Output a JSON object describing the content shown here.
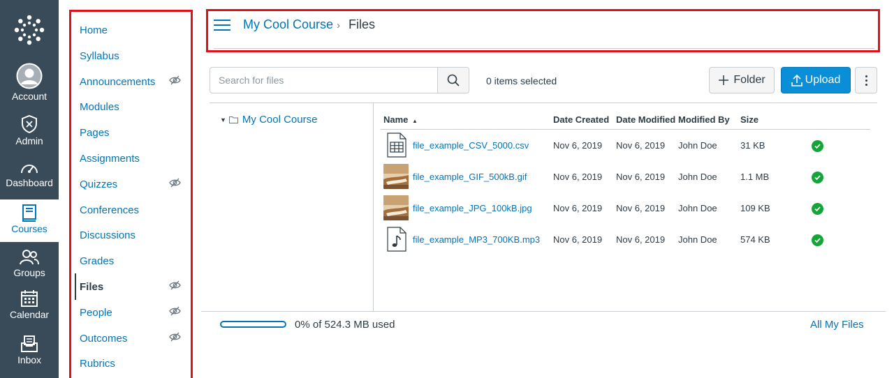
{
  "global_nav": {
    "items": [
      {
        "label": "Account",
        "icon": "account-avatar-icon"
      },
      {
        "label": "Admin",
        "icon": "shield-icon"
      },
      {
        "label": "Dashboard",
        "icon": "speedometer-icon"
      },
      {
        "label": "Courses",
        "icon": "book-icon",
        "active": true
      },
      {
        "label": "Groups",
        "icon": "people-icon"
      },
      {
        "label": "Calendar",
        "icon": "calendar-icon"
      },
      {
        "label": "Inbox",
        "icon": "inbox-icon"
      }
    ]
  },
  "course_nav": {
    "items": [
      {
        "label": "Home"
      },
      {
        "label": "Syllabus"
      },
      {
        "label": "Announcements",
        "hidden": true
      },
      {
        "label": "Modules"
      },
      {
        "label": "Pages"
      },
      {
        "label": "Assignments"
      },
      {
        "label": "Quizzes",
        "hidden": true
      },
      {
        "label": "Conferences"
      },
      {
        "label": "Discussions"
      },
      {
        "label": "Grades"
      },
      {
        "label": "Files",
        "hidden": true,
        "active": true
      },
      {
        "label": "People",
        "hidden": true
      },
      {
        "label": "Outcomes",
        "hidden": true
      },
      {
        "label": "Rubrics"
      }
    ]
  },
  "header": {
    "course": "My Cool Course",
    "separator": "›",
    "current": "Files"
  },
  "toolbar": {
    "search_placeholder": "Search for files",
    "selected_text": "0 items selected",
    "folder_label": "Folder",
    "upload_label": "Upload"
  },
  "tree": {
    "root_label": "My Cool Course"
  },
  "table": {
    "columns": [
      "Name",
      "Date Created",
      "Date Modified",
      "Modified By",
      "Size"
    ],
    "sort_indicator": "▲",
    "rows": [
      {
        "name": "file_example_CSV_5000.csv",
        "created": "Nov 6, 2019",
        "modified": "Nov 6, 2019",
        "by": "John Doe",
        "size": "31 KB",
        "type": "spreadsheet-file-icon"
      },
      {
        "name": "file_example_GIF_500kB.gif",
        "created": "Nov 6, 2019",
        "modified": "Nov 6, 2019",
        "by": "John Doe",
        "size": "1.1 MB",
        "type": "image-thumbnail"
      },
      {
        "name": "file_example_JPG_100kB.jpg",
        "created": "Nov 6, 2019",
        "modified": "Nov 6, 2019",
        "by": "John Doe",
        "size": "109 KB",
        "type": "image-thumbnail"
      },
      {
        "name": "file_example_MP3_700KB.mp3",
        "created": "Nov 6, 2019",
        "modified": "Nov 6, 2019",
        "by": "John Doe",
        "size": "574 KB",
        "type": "audio-file-icon"
      }
    ]
  },
  "footer": {
    "quota_text": "0% of 524.3 MB used",
    "quota_percent": 0,
    "all_files_link": "All My Files"
  },
  "colors": {
    "nav_bg": "#394b58",
    "link": "#0374b5",
    "primary_button": "#0b8ed8",
    "success": "#13a538",
    "highlight_border": "#e2101a"
  }
}
